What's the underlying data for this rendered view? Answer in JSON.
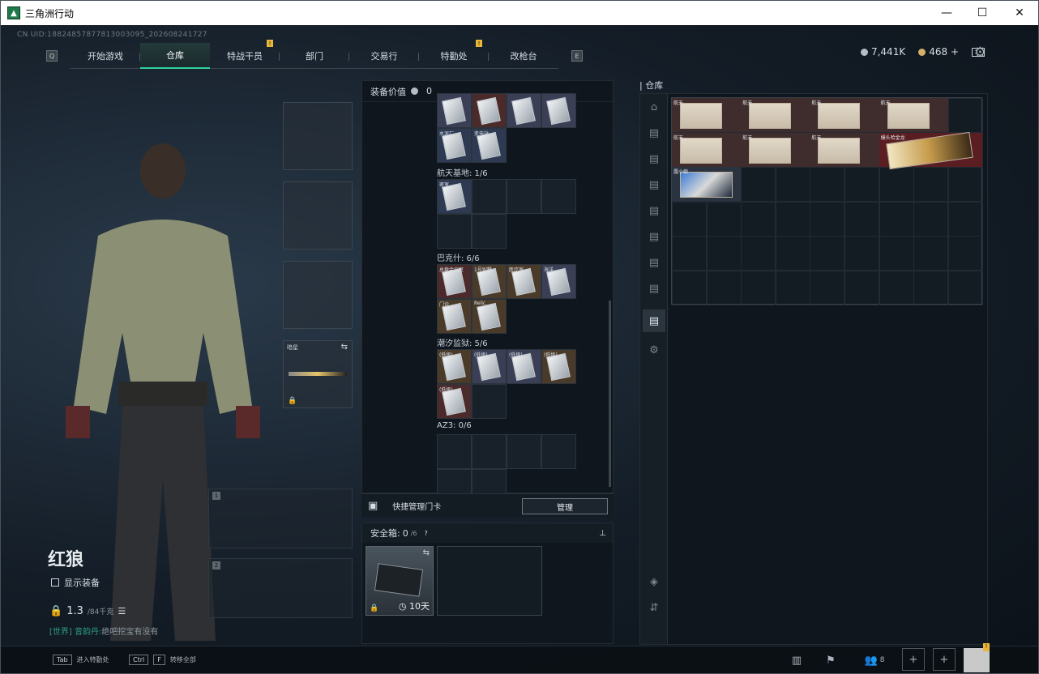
{
  "window": {
    "title": "三角洲行动",
    "minimize": "—",
    "maximize": "☐",
    "close": "✕"
  },
  "uid": "CN UID:18824857877813003095_202608241727",
  "nav": {
    "left_key": "Q",
    "right_key": "E",
    "tabs": [
      {
        "label": "开始游戏",
        "active": false,
        "badge": ""
      },
      {
        "label": "仓库",
        "active": true,
        "badge": ""
      },
      {
        "label": "特战干员",
        "active": false,
        "badge": "!"
      },
      {
        "label": "部门",
        "active": false,
        "badge": ""
      },
      {
        "label": "交易行",
        "active": false,
        "badge": ""
      },
      {
        "label": "特勤处",
        "active": false,
        "badge": "!"
      },
      {
        "label": "改枪台",
        "active": false,
        "badge": ""
      }
    ]
  },
  "currency": {
    "silver": "7,441K",
    "gold": "468",
    "plus": "+"
  },
  "operator": {
    "name": "红狼",
    "show_equipment": "显示装备",
    "weight": "1.3",
    "weight_max": "/84千克"
  },
  "melee_slot": {
    "label": "暗星"
  },
  "chat": {
    "channel": "[世界]",
    "user": "音韵丹:",
    "message": "绝吧挖宝有没有"
  },
  "equipment_panel": {
    "value_label": "装备价值",
    "value": "0",
    "groups": [
      {
        "title": "航天基地: 1/6"
      },
      {
        "title": "巴克什: 6/6"
      },
      {
        "title": "潮汐监狱: 5/6"
      },
      {
        "title": "AZ3: 0/6"
      }
    ],
    "top_cards": [
      "",
      "",
      "",
      "",
      "水泥厂",
      "变电站"
    ],
    "hangtian_cards": [
      "密室"
    ],
    "bakeshi_cards": [
      "总裁会议室",
      "1号别墅",
      "医疗室",
      "海洋",
      "门诊",
      "Relic"
    ],
    "chaoxi_cards": [
      "(低级)",
      "(低级)",
      "(低级)",
      "(低级)",
      "(低级)"
    ]
  },
  "quick": {
    "label": "快捷管理门卡",
    "button": "管理"
  },
  "safe": {
    "label": "安全箱:",
    "count": "0",
    "max": "/6",
    "help": "?",
    "days": "10天"
  },
  "storage": {
    "title": "仓库",
    "row1": [
      "航天",
      "航天",
      "航天",
      "航天"
    ],
    "row2": [
      "航天",
      "航天",
      "航天",
      "爆头哈金龙"
    ],
    "row3": [
      "露小娘"
    ]
  },
  "bottom": {
    "tab_key": "Tab",
    "tab_label": "进入特勤处",
    "ctrl_key": "Ctrl",
    "f_key": "F",
    "ctrl_label": "转移全部",
    "friends": "8"
  }
}
